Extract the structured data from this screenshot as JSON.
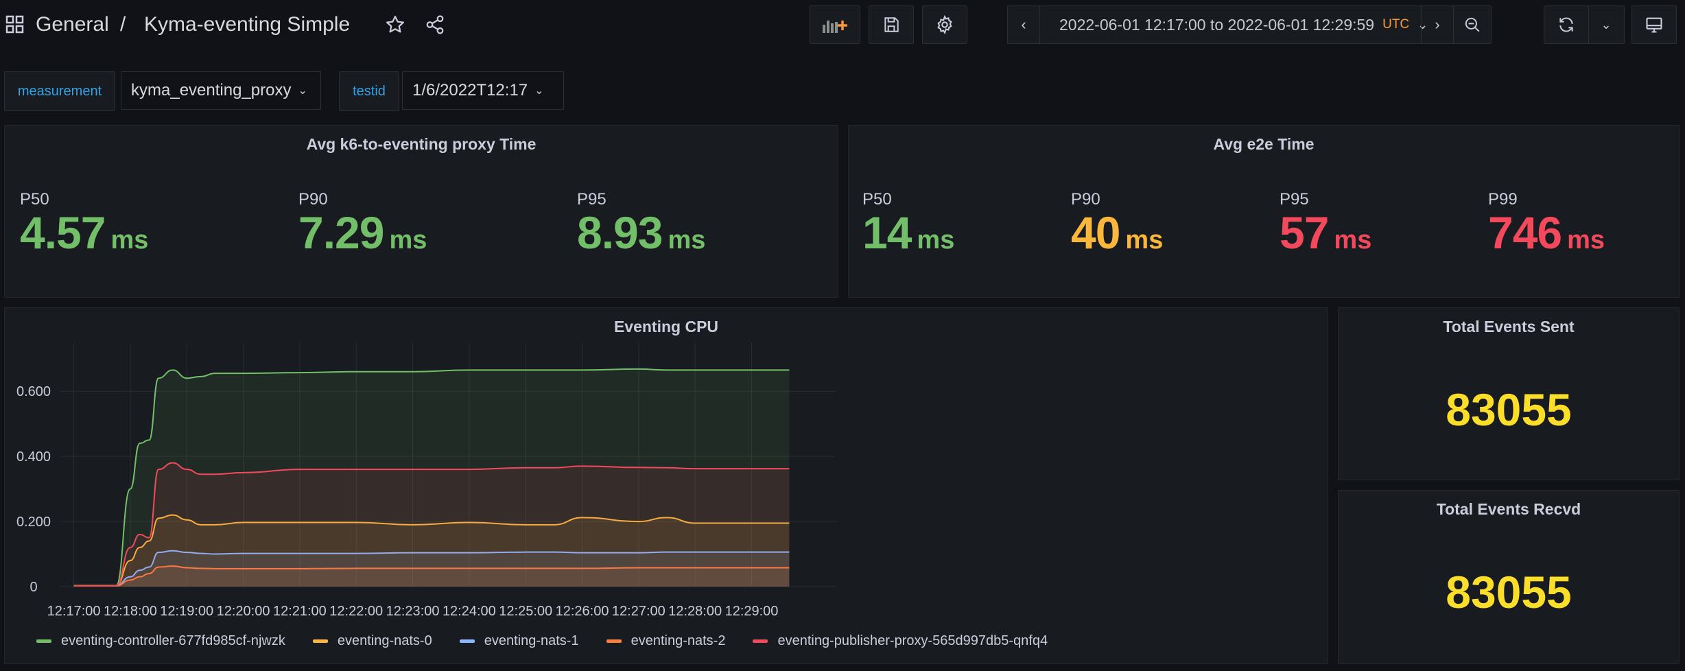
{
  "breadcrumb": {
    "folder": "General",
    "separator": "/",
    "dashboard": "Kyma-eventing Simple"
  },
  "timepicker": {
    "range": "2022-06-01 12:17:00 to 2022-06-01 12:29:59",
    "timezone": "UTC"
  },
  "variables": [
    {
      "label": "measurement",
      "value": "kyma_eventing_proxy"
    },
    {
      "label": "testid",
      "value": "1/6/2022T12:17"
    }
  ],
  "colors": {
    "green": "#73bf69",
    "yellow": "#fade2a",
    "orange": "#f2cc0c",
    "red": "#f2495c",
    "blue": "#33a2e5"
  },
  "panels": {
    "proxy": {
      "title": "Avg k6-to-eventing proxy Time",
      "stats": [
        {
          "label": "P50",
          "value": "4.57",
          "unit": "ms",
          "color": "#73bf69"
        },
        {
          "label": "P90",
          "value": "7.29",
          "unit": "ms",
          "color": "#73bf69"
        },
        {
          "label": "P95",
          "value": "8.93",
          "unit": "ms",
          "color": "#73bf69"
        }
      ]
    },
    "e2e": {
      "title": "Avg e2e Time",
      "stats": [
        {
          "label": "P50",
          "value": "14",
          "unit": "ms",
          "color": "#73bf69"
        },
        {
          "label": "P90",
          "value": "40",
          "unit": "ms",
          "color": "#fab73b"
        },
        {
          "label": "P95",
          "value": "57",
          "unit": "ms",
          "color": "#f2495c"
        },
        {
          "label": "P99",
          "value": "746",
          "unit": "ms",
          "color": "#f2495c"
        }
      ]
    },
    "sent": {
      "title": "Total Events Sent",
      "value": "83055"
    },
    "recvd": {
      "title": "Total Events Recvd",
      "value": "83055"
    },
    "cpu": {
      "title": "Eventing CPU"
    }
  },
  "chart_data": {
    "type": "area",
    "title": "Eventing CPU",
    "x": [
      "12:17:00",
      "12:17:30",
      "12:17:45",
      "12:18:00",
      "12:18:10",
      "12:18:20",
      "12:18:30",
      "12:18:45",
      "12:19:00",
      "12:19:15",
      "12:19:30",
      "12:20:00",
      "12:21:00",
      "12:22:00",
      "12:23:00",
      "12:24:00",
      "12:25:00",
      "12:25:30",
      "12:26:00",
      "12:27:00",
      "12:27:30",
      "12:28:00",
      "12:29:00",
      "12:29:40"
    ],
    "xticks": [
      "12:17:00",
      "12:18:00",
      "12:19:00",
      "12:20:00",
      "12:21:00",
      "12:22:00",
      "12:23:00",
      "12:24:00",
      "12:25:00",
      "12:26:00",
      "12:27:00",
      "12:28:00",
      "12:29:00"
    ],
    "yticks": [
      "0",
      "0.200",
      "0.400",
      "0.600"
    ],
    "ylim": [
      0,
      0.75
    ],
    "grid": true,
    "legend_position": "bottom",
    "series": [
      {
        "name": "eventing-controller-677fd985cf-njwzk",
        "color": "#73bf69",
        "values": [
          0.003,
          0.003,
          0.003,
          0.3,
          0.44,
          0.45,
          0.64,
          0.665,
          0.64,
          0.645,
          0.655,
          0.655,
          0.657,
          0.66,
          0.66,
          0.665,
          0.665,
          0.665,
          0.665,
          0.668,
          0.665,
          0.665,
          0.665,
          0.665
        ]
      },
      {
        "name": "eventing-nats-0",
        "color": "#fab73b",
        "values": [
          0.003,
          0.003,
          0.003,
          0.08,
          0.12,
          0.14,
          0.21,
          0.22,
          0.205,
          0.19,
          0.19,
          0.197,
          0.197,
          0.197,
          0.19,
          0.197,
          0.19,
          0.19,
          0.212,
          0.2,
          0.212,
          0.195,
          0.195,
          0.195
        ]
      },
      {
        "name": "eventing-nats-1",
        "color": "#8ab8ff",
        "values": [
          0.002,
          0.002,
          0.002,
          0.03,
          0.05,
          0.06,
          0.105,
          0.11,
          0.105,
          0.102,
          0.1,
          0.102,
          0.102,
          0.102,
          0.104,
          0.104,
          0.106,
          0.106,
          0.104,
          0.104,
          0.106,
          0.106,
          0.106,
          0.106
        ]
      },
      {
        "name": "eventing-nats-2",
        "color": "#ff7f3f",
        "values": [
          0.002,
          0.002,
          0.002,
          0.02,
          0.03,
          0.04,
          0.06,
          0.063,
          0.058,
          0.056,
          0.055,
          0.055,
          0.055,
          0.056,
          0.056,
          0.056,
          0.056,
          0.056,
          0.056,
          0.058,
          0.058,
          0.058,
          0.058,
          0.058
        ]
      },
      {
        "name": "eventing-publisher-proxy-565d997db5-qnfq4",
        "color": "#f2495c",
        "values": [
          0.002,
          0.002,
          0.002,
          0.12,
          0.16,
          0.15,
          0.36,
          0.38,
          0.36,
          0.345,
          0.345,
          0.35,
          0.36,
          0.36,
          0.36,
          0.36,
          0.365,
          0.365,
          0.37,
          0.366,
          0.365,
          0.362,
          0.362,
          0.362
        ]
      }
    ]
  }
}
